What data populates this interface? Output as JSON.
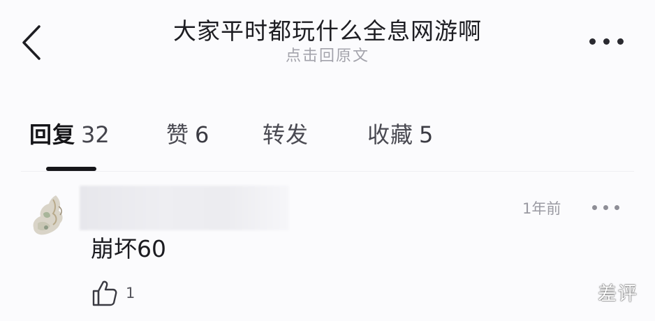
{
  "header": {
    "back_icon": "chevron-left-icon",
    "title": "大家平时都玩什么全息网游啊",
    "subtitle_link": "点击回原文",
    "more_icon": "ellipsis-horizontal-icon"
  },
  "tabs": [
    {
      "label": "回复",
      "count": "32",
      "active": true
    },
    {
      "label": "赞",
      "count": "6",
      "active": false
    },
    {
      "label": "转发",
      "count": "",
      "active": false
    },
    {
      "label": "收藏",
      "count": "5",
      "active": false
    }
  ],
  "comment": {
    "avatar_icon": "avatar-image",
    "username": "",
    "username_redacted": true,
    "time": "1年前",
    "text": "崩坏60",
    "like_icon": "thumbs-up-icon",
    "like_count": "1",
    "more_icon": "ellipsis-horizontal-icon"
  },
  "watermark": "差评",
  "colors": {
    "background": "#fbfbfd",
    "text_primary": "#1d1d22",
    "text_secondary": "#a3a3ab",
    "indicator": "#16161a"
  }
}
